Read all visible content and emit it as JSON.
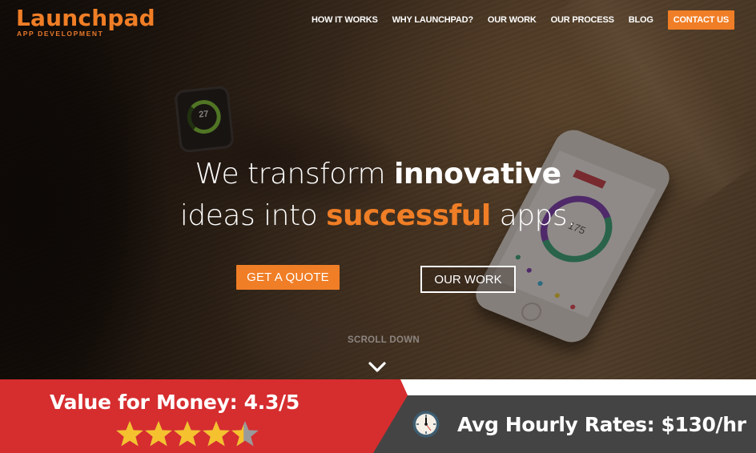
{
  "brand": {
    "name": "Launchpad",
    "tagline": "APP DEVELOPMENT"
  },
  "nav": {
    "items": [
      {
        "label": "HOW IT WORKS"
      },
      {
        "label": "WHY LAUNCHPAD?"
      },
      {
        "label": "OUR WORK"
      },
      {
        "label": "OUR PROCESS"
      },
      {
        "label": "BLOG"
      }
    ],
    "contact_label": "CONTACT US"
  },
  "hero": {
    "line1_light": "We transform ",
    "line1_bold": "innovative",
    "line2_light": "ideas into ",
    "line2_accent": "successful",
    "line2_end": " apps.",
    "primary_cta": "GET A QUOTE",
    "secondary_cta": "OUR WORK",
    "scroll_label": "SCROLL DOWN",
    "watch_value": "27",
    "phone_value": "175"
  },
  "banner": {
    "value_label": "Value for Money: 4.3/5",
    "rating": 4.3,
    "rating_max": 5,
    "rate_label": "Avg Hourly Rates: $130/hr"
  },
  "colors": {
    "accent": "#f07e26",
    "banner_red": "#d62d2f",
    "banner_dark": "#444444",
    "star_fill": "#f5c12e",
    "star_empty": "#9a9a9a"
  }
}
